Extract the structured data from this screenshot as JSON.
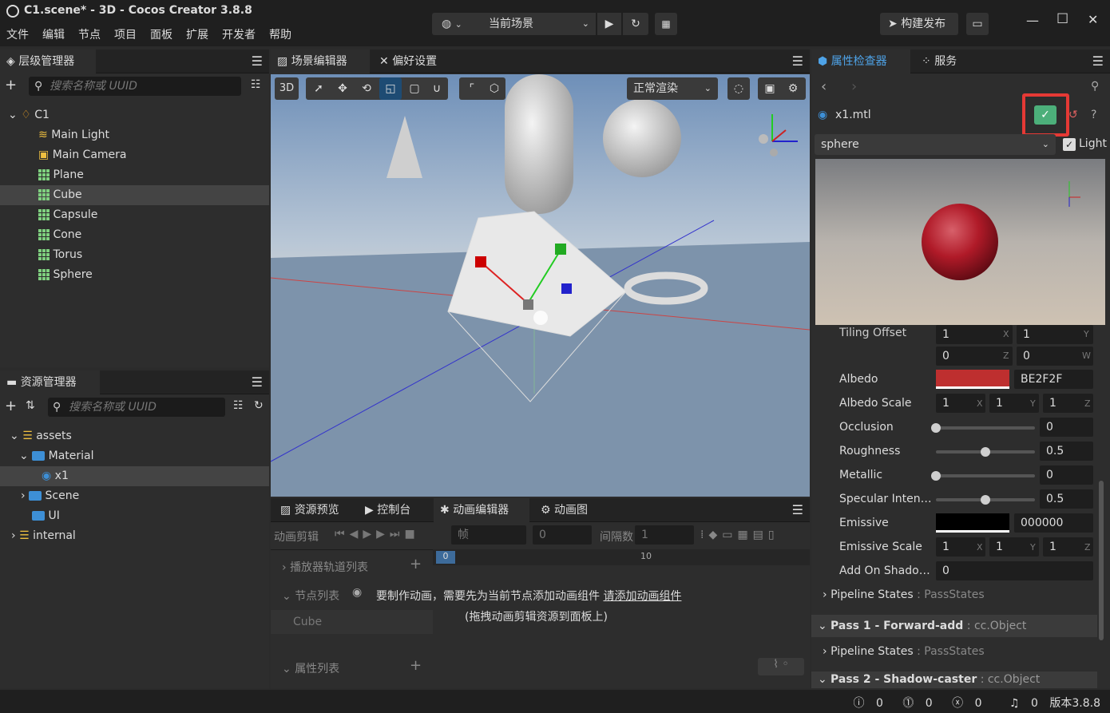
{
  "window": {
    "title": "C1.scene* - 3D - Cocos Creator 3.8.8",
    "min": "—",
    "max": "☐",
    "close": "✕"
  },
  "menu": [
    "文件",
    "编辑",
    "节点",
    "项目",
    "面板",
    "扩展",
    "开发者",
    "帮助"
  ],
  "toolbar": {
    "scene_select": "当前场景",
    "build_label": "构建发布"
  },
  "hierarchy": {
    "tab": "层级管理器",
    "search_placeholder": "搜索名称或 UUID",
    "root": "C1",
    "items": [
      "Main Light",
      "Main Camera",
      "Plane",
      "Cube",
      "Capsule",
      "Cone",
      "Torus",
      "Sphere"
    ],
    "selected": "Cube"
  },
  "assets": {
    "tab": "资源管理器",
    "search_placeholder": "搜索名称或 UUID",
    "items": {
      "assets": "assets",
      "material": "Material",
      "x1": "x1",
      "scene": "Scene",
      "ui": "UI",
      "internal": "internal"
    }
  },
  "scene": {
    "tab_scene": "场景编辑器",
    "tab_prefs": "偏好设置",
    "mode3d": "3D",
    "render_mode": "正常渲染"
  },
  "bottom": {
    "tabs": [
      "资源预览",
      "控制台",
      "动画编辑器",
      "动画图"
    ],
    "clip_label": "动画剪辑",
    "frame_label": "帧",
    "frame_value": "0",
    "interval_label": "间隔数",
    "interval_value": "1",
    "track_list": "播放器轨道列表",
    "node_list": "节点列表",
    "node_cube": "Cube",
    "prop_list": "属性列表",
    "ruler_0": "0",
    "ruler_10": "10",
    "msg1": "要制作动画，需要先为当前节点添加动画组件",
    "msg_link": "请添加动画组件",
    "msg2": "(拖拽动画剪辑资源到面板上)"
  },
  "inspector": {
    "tab": "属性检查器",
    "tab_service": "服务",
    "asset_name": "x1.mtl",
    "preview_mesh": "sphere",
    "light_label": "Light",
    "tiling_label": "Tiling Offset",
    "tiling": [
      "1",
      "1",
      "0",
      "0"
    ],
    "tiling_axes": [
      "X",
      "Y",
      "Z",
      "W"
    ],
    "albedo_label": "Albedo",
    "albedo_hex": "BE2F2F",
    "albedo_color": "#be2f2f",
    "albedo_scale_label": "Albedo Scale",
    "albedo_scale": [
      "1",
      "1",
      "1"
    ],
    "occlusion_label": "Occlusion",
    "occlusion": "0",
    "roughness_label": "Roughness",
    "roughness": "0.5",
    "metallic_label": "Metallic",
    "metallic": "0",
    "specular_label": "Specular Inten…",
    "specular": "0.5",
    "emissive_label": "Emissive",
    "emissive_hex": "000000",
    "emissive_scale_label": "Emissive Scale",
    "emissive_scale": [
      "1",
      "1",
      "1"
    ],
    "add_shadow_label": "Add On Shado…",
    "add_shadow": "0",
    "pipeline_states": "Pipeline States",
    "pass_states": "PassStates",
    "pass1": "Pass 1 - Forward-add",
    "pass2": "Pass 2 - Shadow-caster",
    "cc_object": "cc.Object"
  },
  "status": {
    "info": "0",
    "warn": "0",
    "error": "0",
    "notice": "0",
    "version": "版本3.8.8"
  },
  "colors": {
    "accent": "#3d8fd6",
    "highlight_box": "#e53935",
    "apply_button": "#4caf7a"
  }
}
